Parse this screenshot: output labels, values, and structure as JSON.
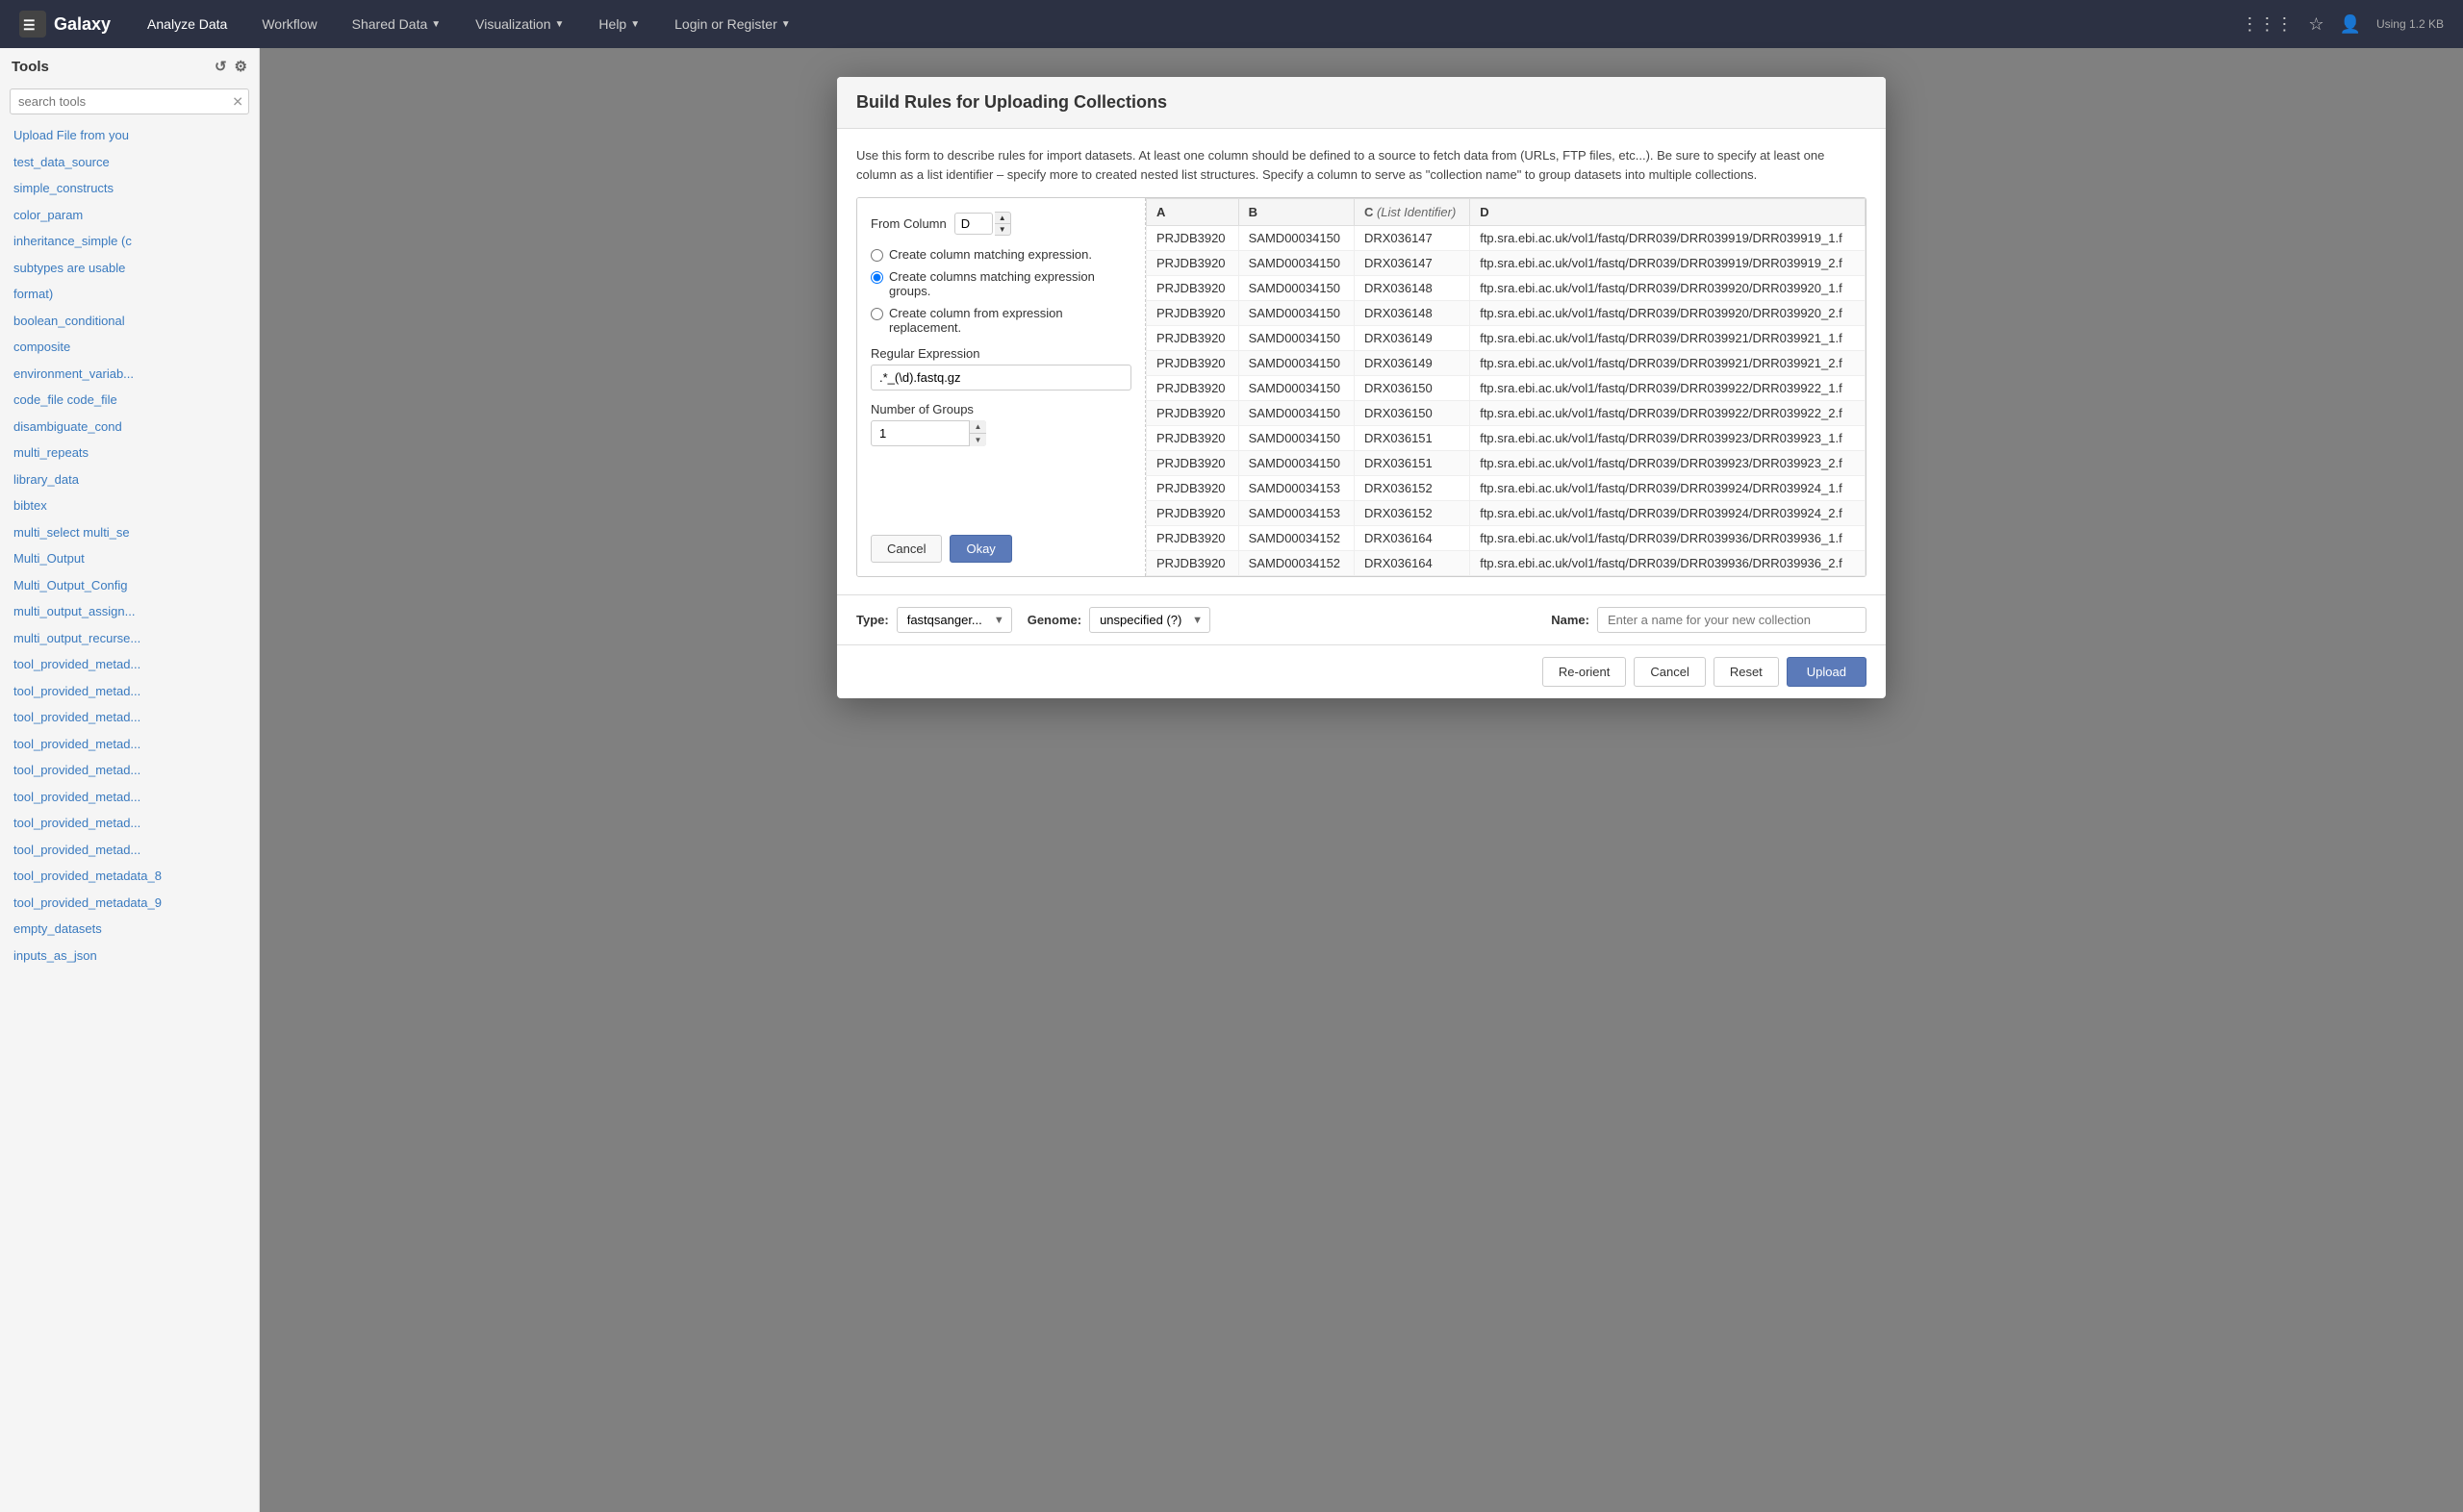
{
  "app": {
    "title": "Galaxy",
    "storage_info": "Using 1.2 KB"
  },
  "top_nav": {
    "items": [
      {
        "id": "analyze",
        "label": "Analyze Data",
        "active": true,
        "has_caret": false
      },
      {
        "id": "workflow",
        "label": "Workflow",
        "active": false,
        "has_caret": false
      },
      {
        "id": "shared-data",
        "label": "Shared Data",
        "active": false,
        "has_caret": true
      },
      {
        "id": "visualization",
        "label": "Visualization",
        "active": false,
        "has_caret": true
      },
      {
        "id": "help",
        "label": "Help",
        "active": false,
        "has_caret": true
      },
      {
        "id": "login",
        "label": "Login or Register",
        "active": false,
        "has_caret": true
      }
    ]
  },
  "sidebar": {
    "header": "Tools",
    "search_placeholder": "search tools",
    "tools": [
      "Upload File from you",
      "test_data_source",
      "simple_constructs",
      "color_param",
      "inheritance_simple (c",
      "subtypes are usable",
      "format)",
      "boolean_conditional",
      "composite",
      "environment_variab...",
      "code_file  code_file",
      "disambiguate_cond",
      "multi_repeats",
      "library_data",
      "bibtex",
      "multi_select multi_se",
      "Multi_Output",
      "Multi_Output_Config",
      "multi_output_assign...",
      "multi_output_recurse...",
      "tool_provided_metad...",
      "tool_provided_metad...",
      "tool_provided_metad...",
      "tool_provided_metad...",
      "tool_provided_metad...",
      "tool_provided_metad...",
      "tool_provided_metad...",
      "tool_provided_metad...",
      "tool_provided_metadata_8",
      "tool_provided_metadata_9",
      "empty_datasets",
      "inputs_as_json"
    ]
  },
  "modal": {
    "title": "Build Rules for Uploading Collections",
    "description": "Use this form to describe rules for import datasets. At least one column should be defined to a source to fetch data from (URLs, FTP files, etc...). Be sure to specify at least one column as a list identifier – specify more to created nested list structures. Specify a column to serve as \"collection name\" to group datasets into multiple collections.",
    "from_column_label": "From Column",
    "from_column_value": "D",
    "radio_options": [
      {
        "id": "create-matching",
        "label": "Create column matching expression.",
        "selected": false
      },
      {
        "id": "create-groups",
        "label": "Create columns matching expression groups.",
        "selected": true
      },
      {
        "id": "create-replacement",
        "label": "Create column from expression replacement.",
        "selected": false
      }
    ],
    "regular_expression_label": "Regular Expression",
    "regular_expression_value": ".*_(\\d).fastq.gz",
    "number_of_groups_label": "Number of Groups",
    "number_of_groups_value": "1",
    "cancel_btn": "Cancel",
    "okay_btn": "Okay",
    "table": {
      "columns": [
        {
          "id": "A",
          "label": "A"
        },
        {
          "id": "B",
          "label": "B"
        },
        {
          "id": "C",
          "label": "C",
          "sub_label": "List Identifier"
        },
        {
          "id": "D",
          "label": "D"
        }
      ],
      "rows": [
        {
          "A": "PRJDB3920",
          "B": "SAMD00034150",
          "C": "DRX036147",
          "D": "ftp.sra.ebi.ac.uk/vol1/fastq/DRR039/DRR039919/DRR039919_1.f"
        },
        {
          "A": "PRJDB3920",
          "B": "SAMD00034150",
          "C": "DRX036147",
          "D": "ftp.sra.ebi.ac.uk/vol1/fastq/DRR039/DRR039919/DRR039919_2.f"
        },
        {
          "A": "PRJDB3920",
          "B": "SAMD00034150",
          "C": "DRX036148",
          "D": "ftp.sra.ebi.ac.uk/vol1/fastq/DRR039/DRR039920/DRR039920_1.f"
        },
        {
          "A": "PRJDB3920",
          "B": "SAMD00034150",
          "C": "DRX036148",
          "D": "ftp.sra.ebi.ac.uk/vol1/fastq/DRR039/DRR039920/DRR039920_2.f"
        },
        {
          "A": "PRJDB3920",
          "B": "SAMD00034150",
          "C": "DRX036149",
          "D": "ftp.sra.ebi.ac.uk/vol1/fastq/DRR039/DRR039921/DRR039921_1.f"
        },
        {
          "A": "PRJDB3920",
          "B": "SAMD00034150",
          "C": "DRX036149",
          "D": "ftp.sra.ebi.ac.uk/vol1/fastq/DRR039/DRR039921/DRR039921_2.f"
        },
        {
          "A": "PRJDB3920",
          "B": "SAMD00034150",
          "C": "DRX036150",
          "D": "ftp.sra.ebi.ac.uk/vol1/fastq/DRR039/DRR039922/DRR039922_1.f"
        },
        {
          "A": "PRJDB3920",
          "B": "SAMD00034150",
          "C": "DRX036150",
          "D": "ftp.sra.ebi.ac.uk/vol1/fastq/DRR039/DRR039922/DRR039922_2.f"
        },
        {
          "A": "PRJDB3920",
          "B": "SAMD00034150",
          "C": "DRX036151",
          "D": "ftp.sra.ebi.ac.uk/vol1/fastq/DRR039/DRR039923/DRR039923_1.f"
        },
        {
          "A": "PRJDB3920",
          "B": "SAMD00034150",
          "C": "DRX036151",
          "D": "ftp.sra.ebi.ac.uk/vol1/fastq/DRR039/DRR039923/DRR039923_2.f"
        },
        {
          "A": "PRJDB3920",
          "B": "SAMD00034153",
          "C": "DRX036152",
          "D": "ftp.sra.ebi.ac.uk/vol1/fastq/DRR039/DRR039924/DRR039924_1.f"
        },
        {
          "A": "PRJDB3920",
          "B": "SAMD00034153",
          "C": "DRX036152",
          "D": "ftp.sra.ebi.ac.uk/vol1/fastq/DRR039/DRR039924/DRR039924_2.f"
        },
        {
          "A": "PRJDB3920",
          "B": "SAMD00034152",
          "C": "DRX036164",
          "D": "ftp.sra.ebi.ac.uk/vol1/fastq/DRR039/DRR039936/DRR039936_1.f"
        },
        {
          "A": "PRJDB3920",
          "B": "SAMD00034152",
          "C": "DRX036164",
          "D": "ftp.sra.ebi.ac.uk/vol1/fastq/DRR039/DRR039936/DRR039936_2.f"
        }
      ]
    },
    "footer": {
      "type_label": "Type:",
      "type_value": "fastqsanger...",
      "genome_label": "Genome:",
      "genome_value": "unspecified (?)",
      "name_label": "Name:",
      "name_placeholder": "Enter a name for your new collection"
    },
    "action_buttons": {
      "reorient": "Re-orient",
      "cancel": "Cancel",
      "reset": "Reset",
      "upload": "Upload"
    }
  }
}
